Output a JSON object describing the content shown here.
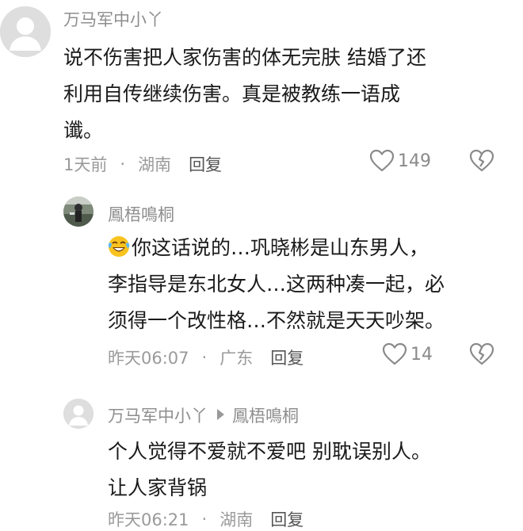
{
  "comments": [
    {
      "username": "万马军中小丫",
      "text_lines": [
        "说不伤害把人家伤害的体无完肤  结婚了还",
        "利用自传继续伤害。真是被教练一语成",
        "谶。"
      ],
      "time": "1天前",
      "separator": "·",
      "location": "湖南",
      "reply_label": "回复",
      "likes": "149",
      "heart_icon": "heart-outline-icon",
      "dislike_icon": "broken-heart-icon"
    },
    {
      "username": "鳳梧鳴桐",
      "emoji": "crying-laughing-emoji",
      "text_lines": [
        "你这话说的…巩晓彬是山东男人，",
        "李指导是东北女人…这两种凑一起，必",
        "须得一个改性格…不然就是天天吵架。"
      ],
      "time": "昨天06:07",
      "separator": "·",
      "location": "广东",
      "reply_label": "回复",
      "likes": "14",
      "heart_icon": "heart-outline-icon",
      "dislike_icon": "broken-heart-icon"
    },
    {
      "username": "万马军中小丫",
      "reply_to": "鳳梧鳴桐",
      "text_lines": [
        "个人觉得不爱就不爱吧   别耽误别人。",
        "让人家背锅"
      ],
      "time": "昨天06:21",
      "separator": "·",
      "location": "湖南",
      "reply_label": "回复"
    }
  ]
}
